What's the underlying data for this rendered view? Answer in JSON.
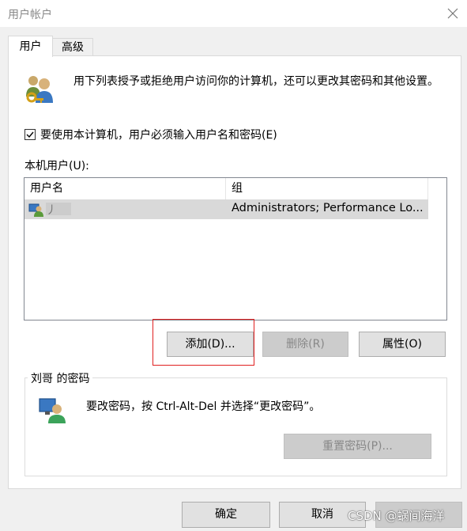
{
  "window": {
    "title": "用户帐户",
    "close_icon": "close-icon"
  },
  "tabs": [
    {
      "label": "用户"
    },
    {
      "label": "高级"
    }
  ],
  "intro": {
    "text": "用下列表授予或拒绝用户访问你的计算机，还可以更改其密码和其他设置。",
    "icon": "users-key-icon"
  },
  "require_password": {
    "checked": true,
    "label": "要使用本计算机，用户必须输入用户名和密码(E)"
  },
  "local_users": {
    "label": "本机用户(U):",
    "columns": [
      "用户名",
      "组"
    ],
    "rows": [
      {
        "name": "丿",
        "group": "Administrators; Performance Lo..."
      }
    ]
  },
  "buttons": {
    "add": "添加(D)...",
    "remove": "删除(R)",
    "properties": "属性(O)"
  },
  "password_group": {
    "title": "刘哥 的密码",
    "text": "要改密码，按 Ctrl-Alt-Del 并选择“更改密码”。",
    "reset_button": "重置密码(P)...",
    "icon": "user-monitor-icon"
  },
  "footer": {
    "ok": "确定",
    "cancel": "取消",
    "apply": ""
  },
  "watermark": "CSDN @蜗间海洋",
  "colors": {
    "highlight_box": "#e02020",
    "selected_row": "#d9d9d9",
    "disabled_text": "#888888"
  }
}
